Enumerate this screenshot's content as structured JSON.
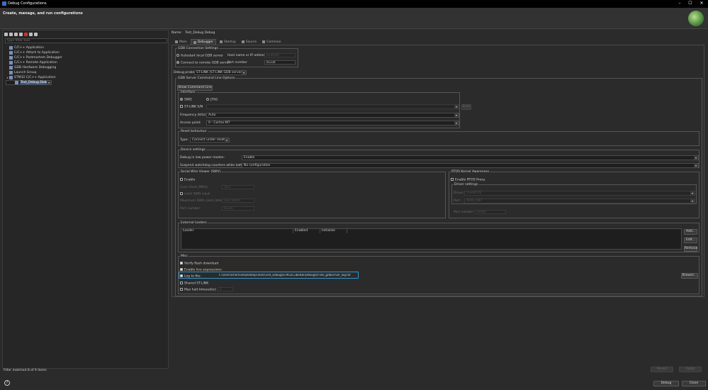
{
  "window": {
    "title": "Debug Configurations"
  },
  "header": {
    "title": "Create, manage, and run configurations"
  },
  "left": {
    "filter_placeholder": "type filter text",
    "tree": [
      {
        "label": "C/C++ Application",
        "indent": 1
      },
      {
        "label": "C/C++ Attach to Application",
        "indent": 1
      },
      {
        "label": "C/C++ Postmortem Debugger",
        "indent": 1
      },
      {
        "label": "C/C++ Remote Application",
        "indent": 1
      },
      {
        "label": "GDB Hardware Debugging",
        "indent": 1
      },
      {
        "label": "Launch Group",
        "indent": 1
      },
      {
        "label": "STM32 C/C++ Application",
        "indent": 1,
        "expanded": true
      },
      {
        "label": "Test_Debug Debug",
        "indent": 2,
        "selected": true
      }
    ],
    "status": "Filter matched 8 of 9 items"
  },
  "config": {
    "name_label": "Name:",
    "name_value": "Test_Debug Debug",
    "tabs": [
      "Main",
      "Debugger",
      "Startup",
      "Source",
      "Common"
    ],
    "active_tab": "Debugger"
  },
  "gdb_conn": {
    "legend": "GDB Connection Settings",
    "autostart": "Autostart local GDB server",
    "remote": "Connect to remote GDB server",
    "host_label": "Host name or IP address",
    "host_value": "localhost",
    "port_label": "Port number",
    "port_value": "61234"
  },
  "probe": {
    "label": "Debug probe",
    "value": "ST-LINK (ST-LINK GDB server)"
  },
  "gdb_opts": {
    "legend": "GDB Server Command Line Options",
    "show_cmd": "Show Command Line"
  },
  "interface": {
    "legend": "Interface",
    "swd": "SWD",
    "jtag": "JTAG",
    "stlink_sn": "ST-LINK S/N",
    "scan": "Scan",
    "freq_label": "Frequency (kHz):",
    "freq_value": "Auto",
    "ap_label": "Access point:",
    "ap_value": "0 - Cortex-M7"
  },
  "reset": {
    "legend": "Reset behaviour",
    "type_label": "Type:",
    "type_value": "Connect under reset"
  },
  "device": {
    "legend": "Device settings",
    "lowpower_label": "Debug in low power modes:",
    "lowpower_value": "Enable",
    "watchdog_label": "Suspend watchdog counters while halted:",
    "watchdog_value": "No configuration"
  },
  "swv": {
    "legend": "Serial Wire Viewer (SWV)",
    "enable": "Enable",
    "core_clock": "Core Clock (MHz):",
    "core_clock_value": "16.0",
    "swo_clock": "Limit SWO clock",
    "max_swo": "Maximum SWO clock (kHz):",
    "max_swo_value": "Auto detect",
    "port_label": "Port number:",
    "port_value": "61235"
  },
  "rtos": {
    "legend": "RTOS Kernel Awareness",
    "enable": "Enable RTOS Proxy",
    "driver_legend": "Driver settings",
    "driver_label": "Driver:",
    "driver_value": "FreeRTOS",
    "port_label": "Port:",
    "port_value": "ARM_CM7",
    "portnum_label": "Port number:",
    "portnum_value": "60000"
  },
  "loaders": {
    "legend": "External loaders",
    "cols": [
      "Loader",
      "Enabled",
      "Initialize"
    ],
    "add": "Add...",
    "edit": "Edit...",
    "remove": "Remove"
  },
  "misc": {
    "legend": "Misc",
    "verify": "Verify flash download",
    "live": "Enable live expressions",
    "log": "Log to file:",
    "log_value": "C:\\Users\\chernise\\Desktop\\Tests\\Test_Debug\\STM32CubeIDE\\Debug\\st-link_gdbserver_log.txt",
    "browse": "Browse...",
    "shared": "Shared ST-LINK",
    "halt": "Max halt timeout(s):",
    "halt_value": "2"
  },
  "actions": {
    "revert": "Revert",
    "apply": "Apply",
    "debug": "Debug",
    "close": "Close"
  },
  "colors": {
    "highlight": "#1d9bd8"
  }
}
